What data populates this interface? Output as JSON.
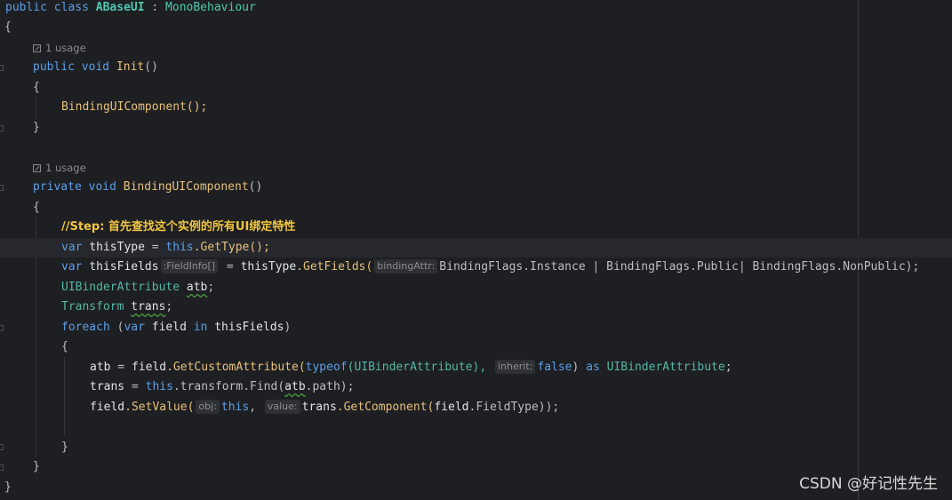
{
  "code": {
    "class_decl": {
      "kw_public": "public",
      "kw_class": "class",
      "name": "ABaseUI",
      "colon": " : ",
      "base": "MonoBehaviour"
    },
    "open_brace": "{",
    "usage_hint": "1 usage",
    "init_decl": {
      "kw_public": "public",
      "kw_void": "void",
      "name": "Init",
      "parens": "()"
    },
    "init_open": "{",
    "init_call": "BindingUIComponent();",
    "init_close": "}",
    "binding_decl": {
      "kw_private": "private",
      "kw_void": "void",
      "name": "BindingUIComponent",
      "parens": "()"
    },
    "binding_open": "{",
    "comment": "//Step: 首先查找这个实例的所有UI绑定特性",
    "line_thistype": {
      "kw_var": "var",
      "name": "thisType",
      "eq": " = ",
      "kw_this": "this",
      "call": ".GetType();"
    },
    "line_thisfields": {
      "kw_var": "var",
      "name": "thisFields",
      "inlay_type": ":FieldInfo[]",
      "eq": " = ",
      "src": "thisType",
      "call": ".GetFields(",
      "inlay_param": "bindingAttr:",
      "args": "BindingFlags.Instance | BindingFlags.Public| BindingFlags.NonPublic);"
    },
    "line_atb": {
      "type": "UIBinderAttribute",
      "name": "atb",
      "semi": ";"
    },
    "line_trans": {
      "type": "Transform",
      "name": "trans",
      "semi": ";"
    },
    "line_foreach": {
      "kw_foreach": "foreach",
      "open": " (",
      "kw_var": "var",
      "name": "field",
      "kw_in": "in",
      "coll": "thisFields",
      "close": ")"
    },
    "foreach_open": "{",
    "line_getattr": {
      "lhs": "atb",
      "eq": " = ",
      "obj": "field",
      "call": ".GetCustomAttribute(",
      "kw_typeof": "typeof",
      "type_arg": "(UIBinderAttribute),",
      "inlay_inherit": "inherit:",
      "kw_false": "false",
      "close": ")",
      "kw_as": "as",
      "cast": "UIBinderAttribute",
      "semi": ";"
    },
    "line_find": {
      "lhs": "trans",
      "eq": " = ",
      "kw_this": "this",
      "mid": ".transform.Find(",
      "arg": "atb",
      "tail": ".path);"
    },
    "line_setvalue": {
      "obj": "field",
      "call": ".SetValue(",
      "inlay_obj": "obj:",
      "kw_this": "this",
      "comma": ",",
      "inlay_value": "value:",
      "arg_obj": "trans",
      "arg_call": ".GetComponent(",
      "arg_field": "field",
      "arg_tail": ".FieldType));"
    },
    "foreach_close": "}",
    "binding_close": "}",
    "class_close": "}"
  },
  "watermark": "CSDN @好记性先生"
}
